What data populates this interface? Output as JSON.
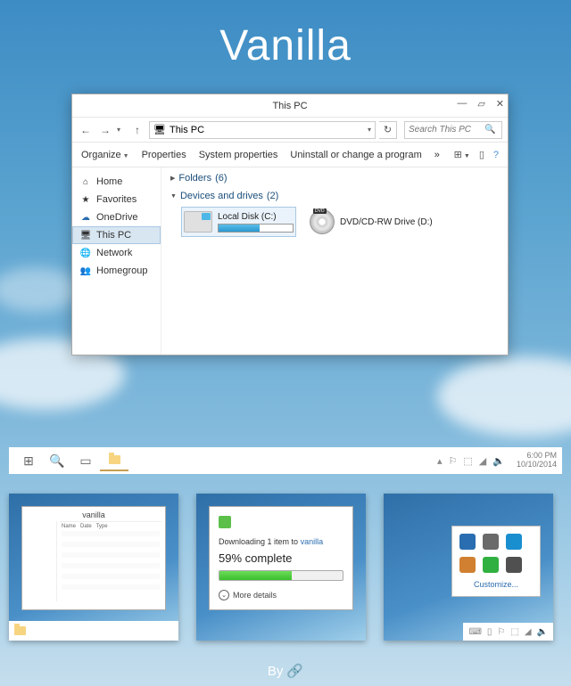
{
  "theme_title": "Vanilla",
  "footer": {
    "by": "By",
    "link_glyph": "🔗"
  },
  "window": {
    "title": "This PC",
    "controls": {
      "min": "—",
      "max": "▱",
      "close": "✕"
    },
    "nav": {
      "back": "←",
      "forward": "→",
      "dropdown": "▾",
      "up": "↑"
    },
    "breadcrumb": {
      "icon": "🖥",
      "label": "This PC",
      "sep": "›",
      "dropdown": "▾",
      "refresh": "↻"
    },
    "search": {
      "placeholder": "Search This PC",
      "icon": "🔍"
    },
    "toolbar": {
      "organize": "Organize",
      "properties": "Properties",
      "system_properties": "System properties",
      "uninstall": "Uninstall or change a program",
      "overflow": "»",
      "view_drop": "⊞",
      "preview": "▯",
      "help": "?"
    },
    "sidebar": [
      {
        "icon": "⌂",
        "label": "Home"
      },
      {
        "icon": "★",
        "label": "Favorites"
      },
      {
        "icon": "☁",
        "label": "OneDrive"
      },
      {
        "icon": "🖥",
        "label": "This PC"
      },
      {
        "icon": "🌐",
        "label": "Network"
      },
      {
        "icon": "👥",
        "label": "Homegroup"
      }
    ],
    "sections": {
      "folders": {
        "label": "Folders",
        "count": "(6)"
      },
      "drives": {
        "label": "Devices and drives",
        "count": "(2)"
      }
    },
    "drives": [
      {
        "name": "Local Disk (C:)",
        "fill_pct": 55
      },
      {
        "name": "DVD/CD-RW Drive (D:)"
      }
    ]
  },
  "taskbar": {
    "items": [
      "⊞",
      "🔍",
      "▭",
      "📁"
    ],
    "tray": {
      "up": "▴",
      "flag": "⚐",
      "net": "⬚",
      "wifi": "◢",
      "vol": "🔈",
      "time": "6:00 PM",
      "date": "10/10/2014"
    }
  },
  "thumbs": {
    "t1": {
      "title": "vanilla"
    },
    "t2": {
      "line_pre": "Downloading 1 item to ",
      "link": "vanilla",
      "pct": "59% complete",
      "fill_pct": 59,
      "more": "More details"
    },
    "t3": {
      "customize": "Customize...",
      "colors": [
        "#2a6db0",
        "#6a6a6a",
        "#1a8fd0",
        "#d08030",
        "#30b040",
        "#505050"
      ],
      "tray_glyphs": [
        "⌨",
        "▯",
        "⚐",
        "⬚",
        "◢",
        "🔈"
      ]
    }
  }
}
